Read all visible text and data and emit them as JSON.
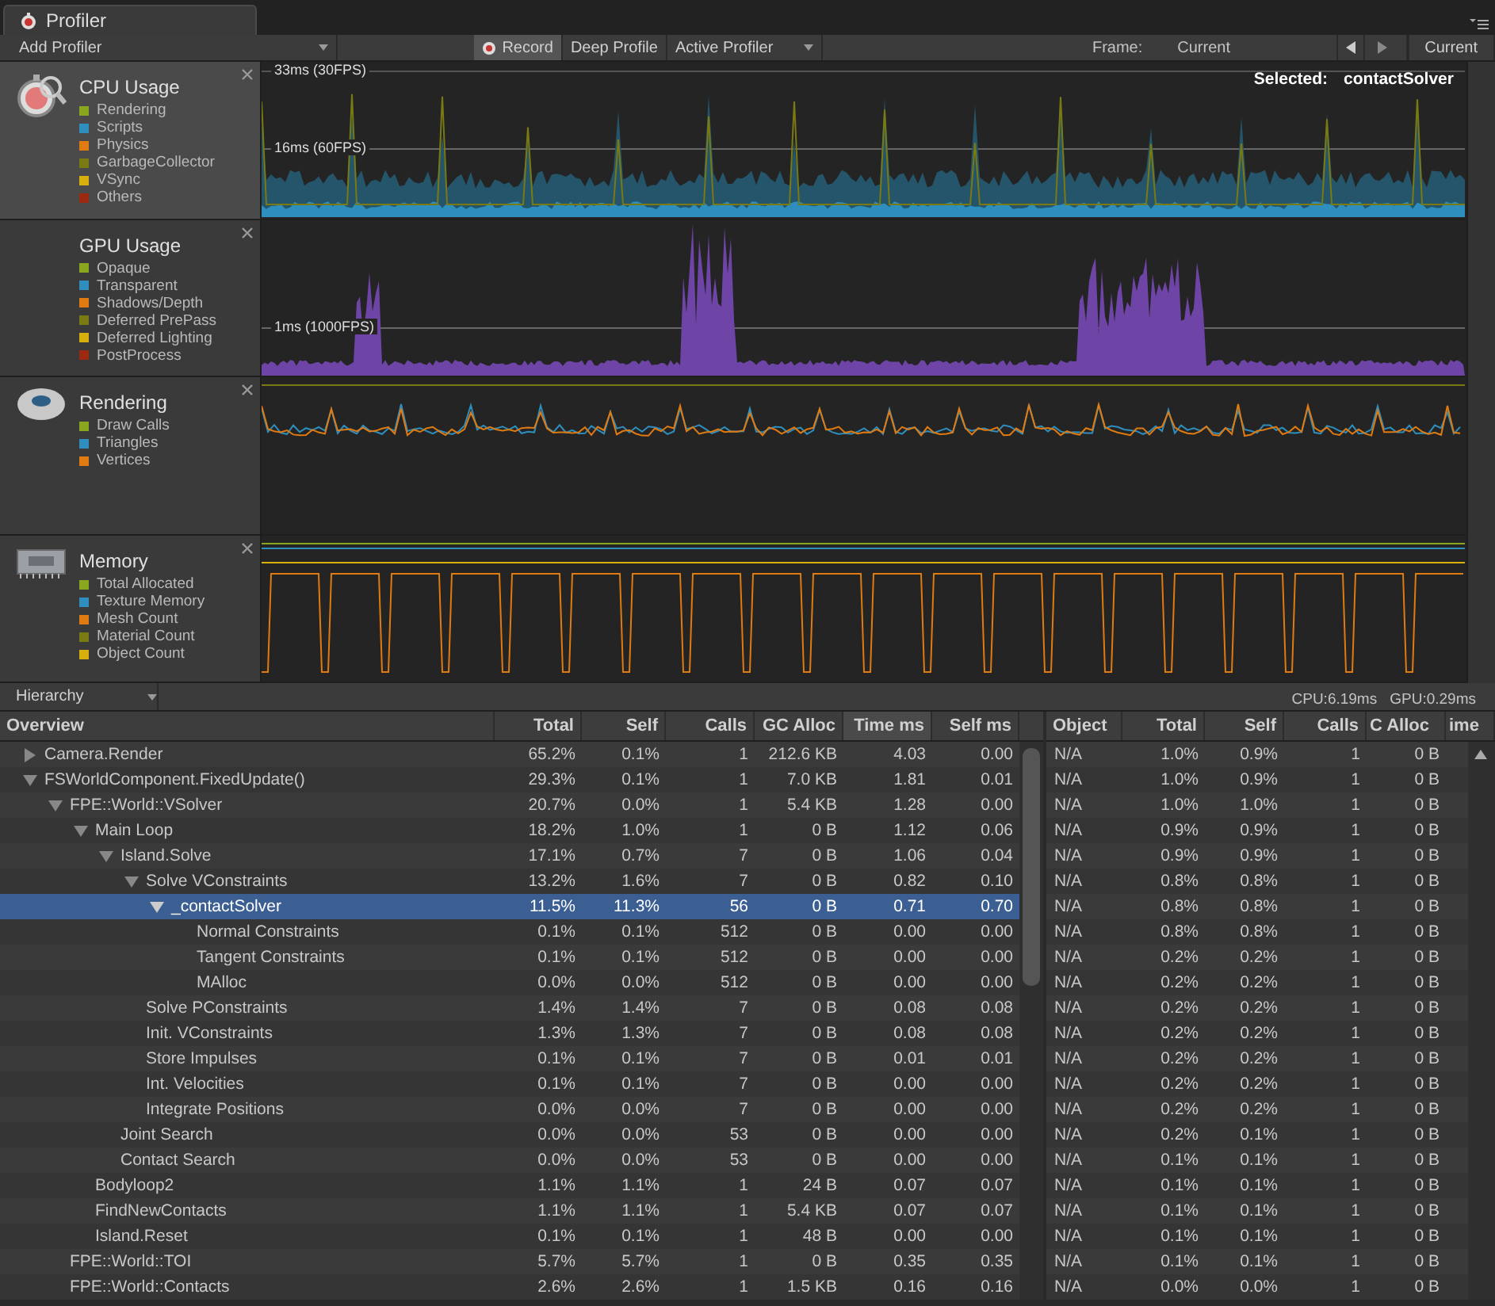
{
  "window": {
    "tab": "Profiler"
  },
  "toolbar": {
    "add_profiler": "Add Profiler",
    "record": {
      "label": "Record",
      "on": true
    },
    "deep_profile": {
      "label": "Deep Profile",
      "on": false
    },
    "active_profiler": "Active Profiler",
    "frame_label": "Frame:",
    "frame_value": "Current",
    "current_button": "Current"
  },
  "profiler_areas": [
    {
      "kind": "cpu",
      "title": "CPU Usage",
      "selected": true,
      "legend": [
        {
          "name": "Rendering",
          "color": "#8aa61e"
        },
        {
          "name": "Scripts",
          "color": "#2e8ebd"
        },
        {
          "name": "Physics",
          "color": "#e07b12"
        },
        {
          "name": "GarbageCollector",
          "color": "#7a7a12"
        },
        {
          "name": "VSync",
          "color": "#d8b00e"
        },
        {
          "name": "Others",
          "color": "#9c2a10"
        }
      ],
      "guides": [
        "33ms (30FPS)",
        "16ms (60FPS)"
      ],
      "selection_label": "Selected:",
      "selection_value": "contactSolver"
    },
    {
      "kind": "gpu",
      "title": "GPU Usage",
      "selected": false,
      "legend": [
        {
          "name": "Opaque",
          "color": "#8aa61e"
        },
        {
          "name": "Transparent",
          "color": "#2e8ebd"
        },
        {
          "name": "Shadows/Depth",
          "color": "#e07b12"
        },
        {
          "name": "Deferred PrePass",
          "color": "#7a7a12"
        },
        {
          "name": "Deferred Lighting",
          "color": "#d8b00e"
        },
        {
          "name": "PostProcess",
          "color": "#9c2a10"
        }
      ],
      "guides": [
        "1ms (1000FPS)"
      ]
    },
    {
      "kind": "rendering",
      "title": "Rendering",
      "selected": false,
      "legend": [
        {
          "name": "Draw Calls",
          "color": "#8aa61e"
        },
        {
          "name": "Triangles",
          "color": "#2e8ebd"
        },
        {
          "name": "Vertices",
          "color": "#e07b12"
        }
      ]
    },
    {
      "kind": "memory",
      "title": "Memory",
      "selected": false,
      "legend": [
        {
          "name": "Total Allocated",
          "color": "#8aa61e"
        },
        {
          "name": "Texture Memory",
          "color": "#2e8ebd"
        },
        {
          "name": "Mesh Count",
          "color": "#e07b12"
        },
        {
          "name": "Material Count",
          "color": "#7a7a12"
        },
        {
          "name": "Object Count",
          "color": "#d8b00e"
        }
      ]
    }
  ],
  "hierarchy_bar": {
    "view": "Hierarchy",
    "cpu": "CPU:6.19ms",
    "gpu": "GPU:0.29ms"
  },
  "hierarchy": {
    "columns": [
      {
        "label": "Overview",
        "selected": false
      },
      {
        "label": "Total",
        "selected": false
      },
      {
        "label": "Self",
        "selected": false
      },
      {
        "label": "Calls",
        "selected": false
      },
      {
        "label": "GC Alloc",
        "selected": false
      },
      {
        "label": "Time ms",
        "selected": true
      },
      {
        "label": "Self ms",
        "selected": false
      }
    ],
    "rows": [
      {
        "name": "Camera.Render",
        "total": "65.2%",
        "self": "0.1%",
        "calls": "1",
        "gc_alloc": "212.6 KB",
        "time_ms": "4.03",
        "self_ms": "0.00",
        "selected": false,
        "expanded": false
      },
      {
        "name": "FSWorldComponent.FixedUpdate()",
        "total": "29.3%",
        "self": "0.1%",
        "calls": "1",
        "gc_alloc": "7.0 KB",
        "time_ms": "1.81",
        "self_ms": "0.01",
        "selected": false,
        "expanded": true,
        "children": [
          {
            "name": "FPE::World::VSolver",
            "total": "20.7%",
            "self": "0.0%",
            "calls": "1",
            "gc_alloc": "5.4 KB",
            "time_ms": "1.28",
            "self_ms": "0.00",
            "selected": false,
            "expanded": true,
            "children": [
              {
                "name": "Main Loop",
                "total": "18.2%",
                "self": "1.0%",
                "calls": "1",
                "gc_alloc": "0 B",
                "time_ms": "1.12",
                "self_ms": "0.06",
                "selected": false,
                "expanded": true,
                "children": [
                  {
                    "name": "Island.Solve",
                    "total": "17.1%",
                    "self": "0.7%",
                    "calls": "7",
                    "gc_alloc": "0 B",
                    "time_ms": "1.06",
                    "self_ms": "0.04",
                    "selected": false,
                    "expanded": true,
                    "children": [
                      {
                        "name": "Solve VConstraints",
                        "total": "13.2%",
                        "self": "1.6%",
                        "calls": "7",
                        "gc_alloc": "0 B",
                        "time_ms": "0.82",
                        "self_ms": "0.10",
                        "selected": false,
                        "expanded": true,
                        "children": [
                          {
                            "name": "_contactSolver",
                            "total": "11.5%",
                            "self": "11.3%",
                            "calls": "56",
                            "gc_alloc": "0 B",
                            "time_ms": "0.71",
                            "self_ms": "0.70",
                            "selected": true,
                            "expanded": true,
                            "children": [
                              {
                                "name": "Normal Constraints",
                                "total": "0.1%",
                                "self": "0.1%",
                                "calls": "512",
                                "gc_alloc": "0 B",
                                "time_ms": "0.00",
                                "self_ms": "0.00",
                                "selected": false
                              },
                              {
                                "name": "Tangent Constraints",
                                "total": "0.1%",
                                "self": "0.1%",
                                "calls": "512",
                                "gc_alloc": "0 B",
                                "time_ms": "0.00",
                                "self_ms": "0.00",
                                "selected": false
                              },
                              {
                                "name": "MAlloc",
                                "total": "0.0%",
                                "self": "0.0%",
                                "calls": "512",
                                "gc_alloc": "0 B",
                                "time_ms": "0.00",
                                "self_ms": "0.00",
                                "selected": false
                              }
                            ]
                          }
                        ]
                      },
                      {
                        "name": "Solve PConstraints",
                        "total": "1.4%",
                        "self": "1.4%",
                        "calls": "7",
                        "gc_alloc": "0 B",
                        "time_ms": "0.08",
                        "self_ms": "0.08",
                        "selected": false
                      },
                      {
                        "name": "Init. VConstraints",
                        "total": "1.3%",
                        "self": "1.3%",
                        "calls": "7",
                        "gc_alloc": "0 B",
                        "time_ms": "0.08",
                        "self_ms": "0.08",
                        "selected": false
                      },
                      {
                        "name": "Store Impulses",
                        "total": "0.1%",
                        "self": "0.1%",
                        "calls": "7",
                        "gc_alloc": "0 B",
                        "time_ms": "0.01",
                        "self_ms": "0.01",
                        "selected": false
                      },
                      {
                        "name": "Int. Velocities",
                        "total": "0.1%",
                        "self": "0.1%",
                        "calls": "7",
                        "gc_alloc": "0 B",
                        "time_ms": "0.00",
                        "self_ms": "0.00",
                        "selected": false
                      },
                      {
                        "name": "Integrate Positions",
                        "total": "0.0%",
                        "self": "0.0%",
                        "calls": "7",
                        "gc_alloc": "0 B",
                        "time_ms": "0.00",
                        "self_ms": "0.00",
                        "selected": false
                      }
                    ]
                  },
                  {
                    "name": "Joint Search",
                    "total": "0.0%",
                    "self": "0.0%",
                    "calls": "53",
                    "gc_alloc": "0 B",
                    "time_ms": "0.00",
                    "self_ms": "0.00",
                    "selected": false
                  },
                  {
                    "name": "Contact Search",
                    "total": "0.0%",
                    "self": "0.0%",
                    "calls": "53",
                    "gc_alloc": "0 B",
                    "time_ms": "0.00",
                    "self_ms": "0.00",
                    "selected": false
                  }
                ]
              },
              {
                "name": "Bodyloop2",
                "total": "1.1%",
                "self": "1.1%",
                "calls": "1",
                "gc_alloc": "24 B",
                "time_ms": "0.07",
                "self_ms": "0.07",
                "selected": false
              },
              {
                "name": "FindNewContacts",
                "total": "1.1%",
                "self": "1.1%",
                "calls": "1",
                "gc_alloc": "5.4 KB",
                "time_ms": "0.07",
                "self_ms": "0.07",
                "selected": false
              },
              {
                "name": "Island.Reset",
                "total": "0.1%",
                "self": "0.1%",
                "calls": "1",
                "gc_alloc": "48 B",
                "time_ms": "0.00",
                "self_ms": "0.00",
                "selected": false
              }
            ]
          },
          {
            "name": "FPE::World::TOI",
            "total": "5.7%",
            "self": "5.7%",
            "calls": "1",
            "gc_alloc": "0 B",
            "time_ms": "0.35",
            "self_ms": "0.35",
            "selected": false
          },
          {
            "name": "FPE::World::Contacts",
            "total": "2.6%",
            "self": "2.6%",
            "calls": "1",
            "gc_alloc": "1.5 KB",
            "time_ms": "0.16",
            "self_ms": "0.16",
            "selected": false
          }
        ]
      }
    ]
  },
  "details": {
    "columns": [
      "Object",
      "Total",
      "Self",
      "Calls",
      "C Alloc",
      "ime"
    ],
    "rows": [
      {
        "object": "N/A",
        "total": "1.0%",
        "self": "0.9%",
        "calls": "1",
        "gc_alloc": "0 B"
      },
      {
        "object": "N/A",
        "total": "1.0%",
        "self": "0.9%",
        "calls": "1",
        "gc_alloc": "0 B"
      },
      {
        "object": "N/A",
        "total": "1.0%",
        "self": "1.0%",
        "calls": "1",
        "gc_alloc": "0 B"
      },
      {
        "object": "N/A",
        "total": "0.9%",
        "self": "0.9%",
        "calls": "1",
        "gc_alloc": "0 B"
      },
      {
        "object": "N/A",
        "total": "0.9%",
        "self": "0.9%",
        "calls": "1",
        "gc_alloc": "0 B"
      },
      {
        "object": "N/A",
        "total": "0.8%",
        "self": "0.8%",
        "calls": "1",
        "gc_alloc": "0 B"
      },
      {
        "object": "N/A",
        "total": "0.8%",
        "self": "0.8%",
        "calls": "1",
        "gc_alloc": "0 B"
      },
      {
        "object": "N/A",
        "total": "0.8%",
        "self": "0.8%",
        "calls": "1",
        "gc_alloc": "0 B"
      },
      {
        "object": "N/A",
        "total": "0.2%",
        "self": "0.2%",
        "calls": "1",
        "gc_alloc": "0 B"
      },
      {
        "object": "N/A",
        "total": "0.2%",
        "self": "0.2%",
        "calls": "1",
        "gc_alloc": "0 B"
      },
      {
        "object": "N/A",
        "total": "0.2%",
        "self": "0.2%",
        "calls": "1",
        "gc_alloc": "0 B"
      },
      {
        "object": "N/A",
        "total": "0.2%",
        "self": "0.2%",
        "calls": "1",
        "gc_alloc": "0 B"
      },
      {
        "object": "N/A",
        "total": "0.2%",
        "self": "0.2%",
        "calls": "1",
        "gc_alloc": "0 B"
      },
      {
        "object": "N/A",
        "total": "0.2%",
        "self": "0.2%",
        "calls": "1",
        "gc_alloc": "0 B"
      },
      {
        "object": "N/A",
        "total": "0.2%",
        "self": "0.2%",
        "calls": "1",
        "gc_alloc": "0 B"
      },
      {
        "object": "N/A",
        "total": "0.2%",
        "self": "0.1%",
        "calls": "1",
        "gc_alloc": "0 B"
      },
      {
        "object": "N/A",
        "total": "0.1%",
        "self": "0.1%",
        "calls": "1",
        "gc_alloc": "0 B"
      },
      {
        "object": "N/A",
        "total": "0.1%",
        "self": "0.1%",
        "calls": "1",
        "gc_alloc": "0 B"
      },
      {
        "object": "N/A",
        "total": "0.1%",
        "self": "0.1%",
        "calls": "1",
        "gc_alloc": "0 B"
      },
      {
        "object": "N/A",
        "total": "0.1%",
        "self": "0.1%",
        "calls": "1",
        "gc_alloc": "0 B"
      },
      {
        "object": "N/A",
        "total": "0.1%",
        "self": "0.1%",
        "calls": "1",
        "gc_alloc": "0 B"
      },
      {
        "object": "N/A",
        "total": "0.0%",
        "self": "0.0%",
        "calls": "1",
        "gc_alloc": "0 B"
      }
    ]
  }
}
